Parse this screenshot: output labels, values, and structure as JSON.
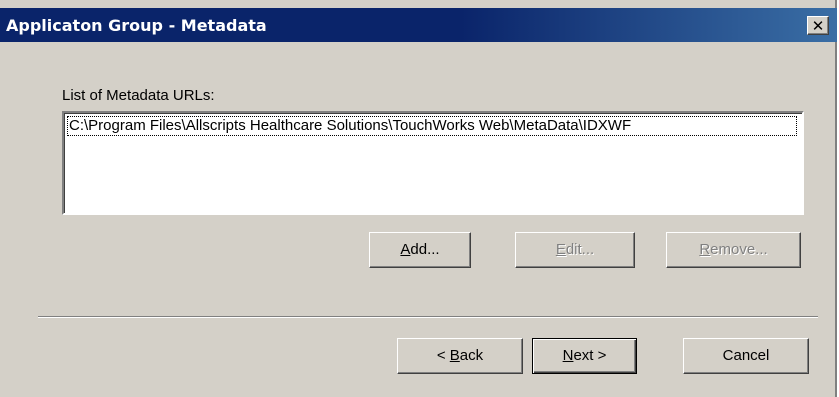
{
  "window": {
    "title": "Applicaton Group - Metadata",
    "close_glyph": "✕"
  },
  "metadata": {
    "list_label": "List of Metadata URLs:",
    "urls": [
      "C:\\Program Files\\Allscripts Healthcare Solutions\\TouchWorks Web\\MetaData\\IDXWF"
    ],
    "buttons": {
      "add": {
        "mnemonic": "A",
        "rest": "dd..."
      },
      "edit": {
        "mnemonic": "E",
        "rest": "dit..."
      },
      "remove": {
        "mnemonic": "R",
        "rest": "emove..."
      }
    }
  },
  "footer": {
    "back": {
      "prefix": "< ",
      "mnemonic": "B",
      "rest": "ack"
    },
    "next": {
      "mnemonic": "N",
      "rest": "ext >"
    },
    "cancel_label": "Cancel"
  },
  "colors": {
    "title_bar": "#0a246a",
    "dialog_face": "#d4d0c8",
    "disabled_text": "#808080"
  }
}
